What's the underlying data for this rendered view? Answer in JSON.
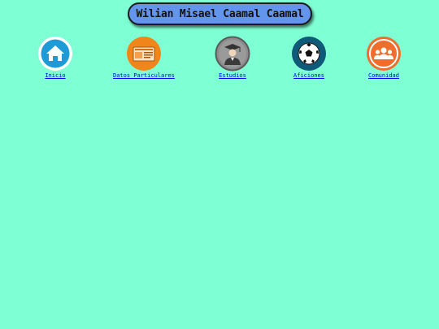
{
  "header": {
    "title": "Wilian Misael Caamal Caamal"
  },
  "nav": {
    "items": [
      {
        "label": "Inicio",
        "icon": "home-icon"
      },
      {
        "label": "Datos Particulares",
        "icon": "id-card-icon"
      },
      {
        "label": "Estudios",
        "icon": "graduate-icon"
      },
      {
        "label": "Aficiones",
        "icon": "soccer-ball-icon"
      },
      {
        "label": "Comunidad",
        "icon": "community-icon"
      }
    ]
  },
  "colors": {
    "background": "#7fffd4",
    "title_bg": "#6495ed",
    "link": "#0000ee",
    "home": "#1e9ad6",
    "id_card": "#f0861b",
    "graduate": "#8c8c8c",
    "soccer": "#0e5a78",
    "community": "#ef6d2d"
  }
}
